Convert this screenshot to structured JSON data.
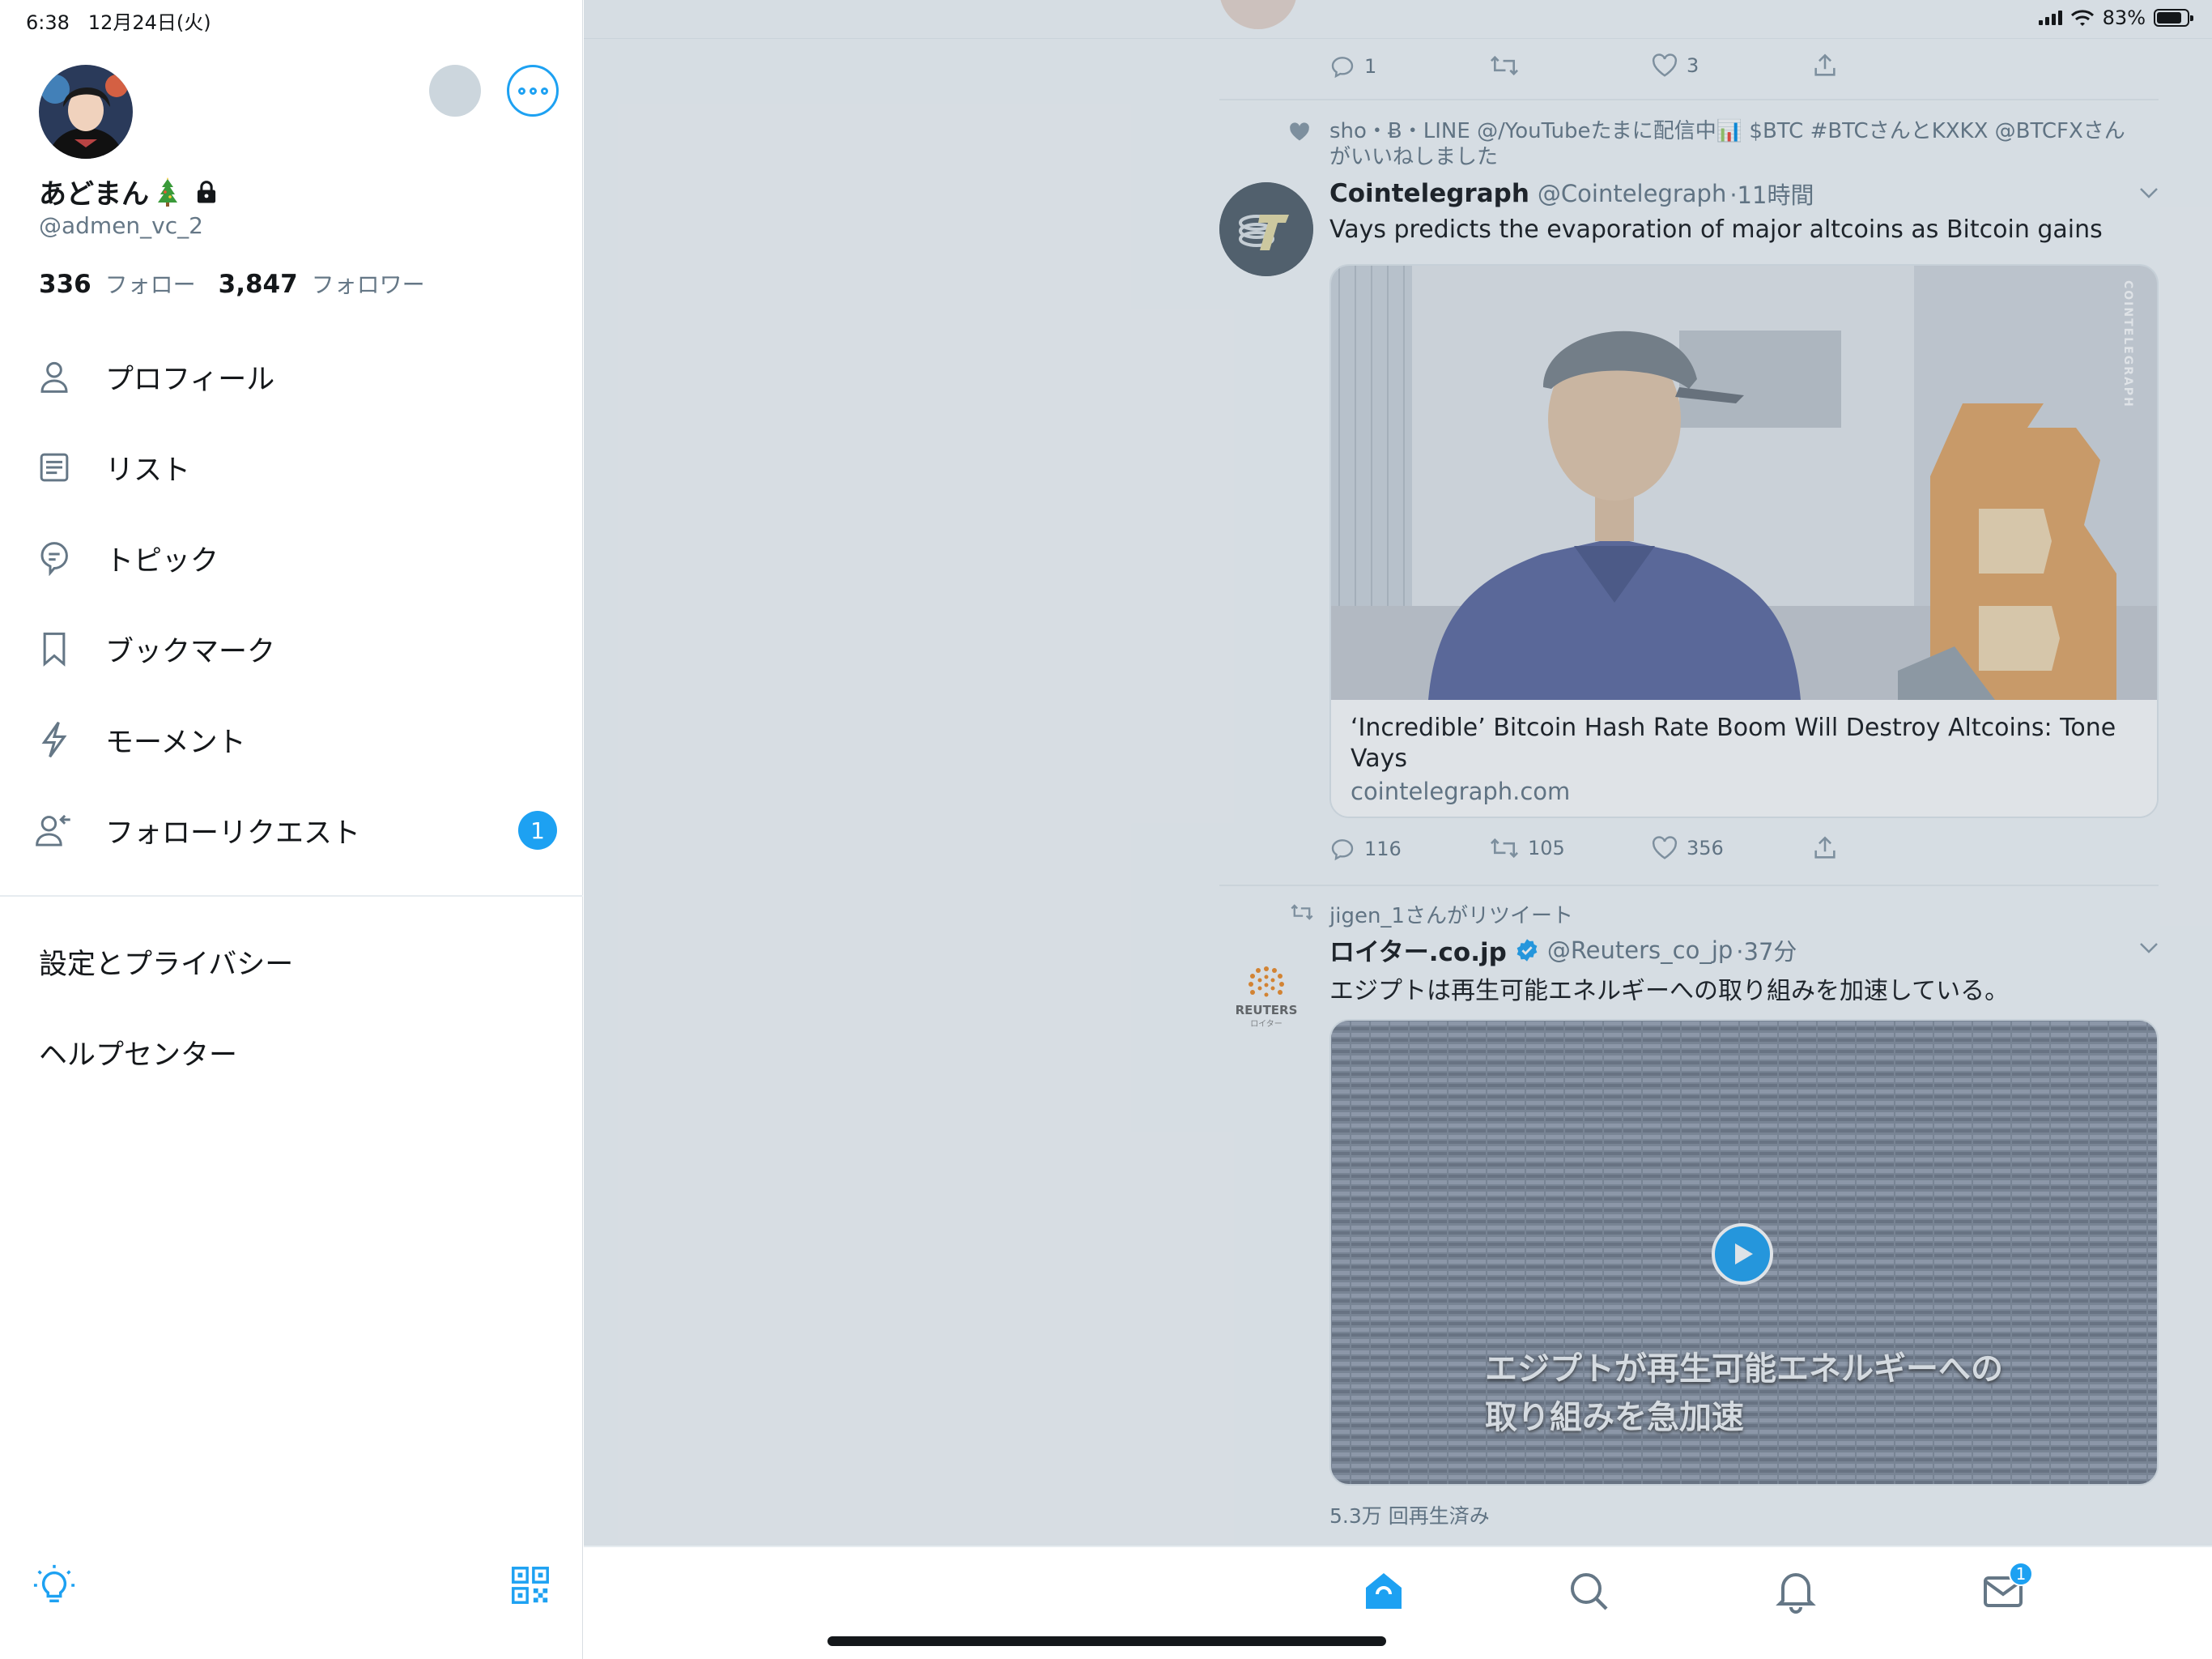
{
  "status": {
    "time": "6:38",
    "date": "12月24日(火)",
    "battery": "83%",
    "battery_level": 0.83
  },
  "profile": {
    "display_name": "あどまん",
    "handle": "@admen_vc_2",
    "following_count": "336",
    "following_label": "フォロー",
    "followers_count": "3,847",
    "followers_label": "フォロワー"
  },
  "menu": {
    "items": [
      {
        "label": "プロフィール",
        "icon": "person-icon"
      },
      {
        "label": "リスト",
        "icon": "list-icon"
      },
      {
        "label": "トピック",
        "icon": "topic-icon"
      },
      {
        "label": "ブックマーク",
        "icon": "bookmark-icon"
      },
      {
        "label": "モーメント",
        "icon": "lightning-icon"
      },
      {
        "label": "フォローリクエスト",
        "icon": "follow-request-icon",
        "badge": "1"
      }
    ],
    "settings_label": "設定とプライバシー",
    "help_label": "ヘルプセンター"
  },
  "feed": {
    "prev_tweet": {
      "replies": "1",
      "likes": "3"
    },
    "tweet1": {
      "social_context_line1": "sho・Ƀ・LINE @/YouTubeたまに配信中📊 $BTC #BTCさんとKXKX @BTCFXさん",
      "social_context_line2": "がいいねしました",
      "name": "Cointelegraph",
      "handle": "@Cointelegraph",
      "time": "·11時間",
      "text": "Vays predicts the evaporation of major altcoins as Bitcoin gains",
      "card_title": "‘Incredible’ Bitcoin Hash Rate Boom Will Destroy Altcoins: Tone Vays",
      "card_domain": "cointelegraph.com",
      "watermark": "COINTELEGRAPH",
      "replies": "116",
      "retweets": "105",
      "likes": "356"
    },
    "tweet2": {
      "social_context": "jigen_1さんがリツイート",
      "name": "ロイター.co.jp",
      "handle": "@Reuters_co_jp",
      "time": "·37分",
      "text": "エジプトは再生可能エネルギーへの取り組みを加速している。",
      "video_caption_line1": "エジプトが再生可能エネルギーへの",
      "video_caption_line2": "取り組みを急加速",
      "views": "5.3万 回再生済み",
      "logo_text": "REUTERS",
      "logo_sub": "ロイター"
    }
  },
  "tabbar": {
    "messages_badge": "1"
  },
  "colors": {
    "accent": "#1da1f2",
    "text_primary": "#14171a",
    "text_secondary": "#657786"
  }
}
